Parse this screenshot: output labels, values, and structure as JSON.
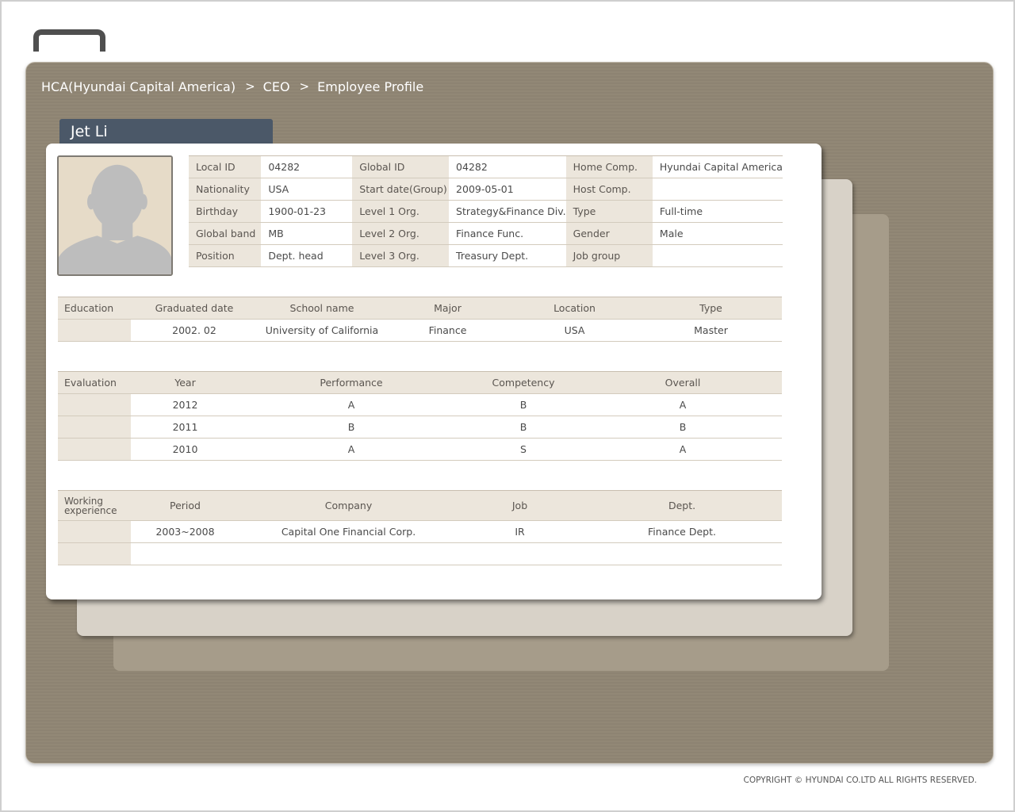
{
  "breadcrumb": {
    "company": "HCA(Hyundai Capital America)",
    "level": "CEO",
    "page": "Employee Profile"
  },
  "employee": {
    "name": "Jet Li"
  },
  "info": {
    "local_id_label": "Local ID",
    "local_id": "04282",
    "global_id_label": "Global ID",
    "global_id": "04282",
    "home_comp_label": "Home Comp.",
    "home_comp": "Hyundai Capital America",
    "nationality_label": "Nationality",
    "nationality": "USA",
    "start_date_label": "Start date(Group)",
    "start_date": "2009-05-01",
    "host_comp_label": "Host Comp.",
    "host_comp": "",
    "birthday_label": "Birthday",
    "birthday": "1900-01-23",
    "level1_label": "Level 1 Org.",
    "level1": "Strategy&Finance Div.",
    "type_label": "Type",
    "type": "Full-time",
    "global_band_label": "Global band",
    "global_band": "MB",
    "level2_label": "Level 2 Org.",
    "level2": "Finance Func.",
    "gender_label": "Gender",
    "gender": "Male",
    "position_label": "Position",
    "position": "Dept. head",
    "level3_label": "Level 3 Org.",
    "level3": "Treasury Dept.",
    "job_group_label": "Job group",
    "job_group": ""
  },
  "education": {
    "title": "Education",
    "headers": [
      "Graduated date",
      "School name",
      "Major",
      "Location",
      "Type"
    ],
    "rows": [
      [
        "2002. 02",
        "University of California",
        "Finance",
        "USA",
        "Master"
      ]
    ]
  },
  "evaluation": {
    "title": "Evaluation",
    "headers": [
      "Year",
      "Performance",
      "Competency",
      "Overall"
    ],
    "rows": [
      [
        "2012",
        "A",
        "B",
        "A"
      ],
      [
        "2011",
        "B",
        "B",
        "B"
      ],
      [
        "2010",
        "A",
        "S",
        "A"
      ]
    ]
  },
  "work": {
    "title_line1": "Working",
    "title_line2": "experience",
    "headers": [
      "Period",
      "Company",
      "Job",
      "Dept."
    ],
    "rows": [
      [
        "2003~2008",
        "Capital One Financial Corp.",
        "IR",
        "Finance Dept."
      ]
    ]
  },
  "footer": {
    "copyright": "COPYRIGHT © HYUNDAI  CO.LTD ALL RIGHTS RESERVED."
  },
  "colors": {
    "panel": "#8d8372",
    "tab": "#4b5868",
    "label_bg": "#ece6dc"
  }
}
